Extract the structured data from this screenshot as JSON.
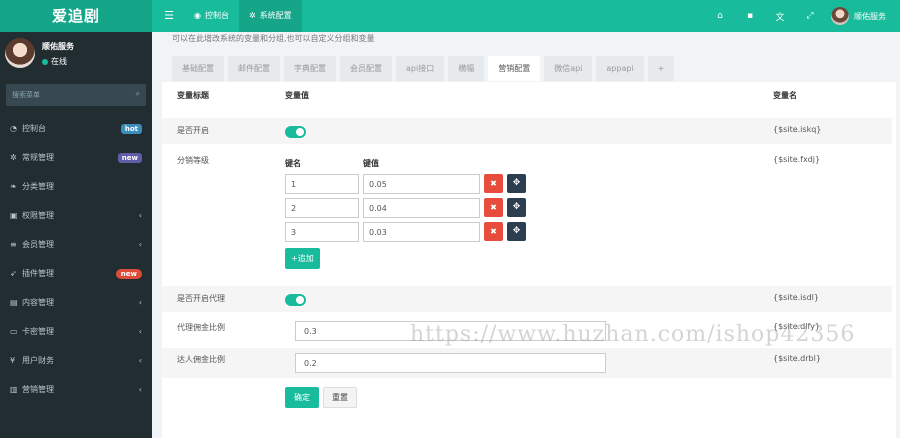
{
  "app": {
    "logo": "爱追剧"
  },
  "topnav": {
    "menu_icon": "menu-icon",
    "items": [
      {
        "icon": "dashboard-icon",
        "label": "控制台"
      },
      {
        "icon": "gear-icon",
        "label": "系统配置"
      }
    ],
    "right_icons": [
      "home-icon",
      "trash-icon",
      "translate-icon",
      "fullscreen-icon"
    ],
    "user_name": "顺佑服务"
  },
  "sidebar": {
    "user_name": "顺佑服务",
    "status": "在线",
    "search_placeholder": "搜索菜单",
    "items": [
      {
        "icon": "dashboard-icon",
        "label": "控制台",
        "badge": "hot"
      },
      {
        "icon": "cogs-icon",
        "label": "常规管理",
        "badge": "new"
      },
      {
        "icon": "leaf-icon",
        "label": "分类管理"
      },
      {
        "icon": "group-icon",
        "label": "权限管理"
      },
      {
        "icon": "list-icon",
        "label": "会员管理"
      },
      {
        "icon": "rocket-icon",
        "label": "插件管理",
        "badge": "new"
      },
      {
        "icon": "file-icon",
        "label": "内容管理"
      },
      {
        "icon": "card-icon",
        "label": "卡密管理"
      },
      {
        "icon": "yen-icon",
        "label": "用户财务"
      },
      {
        "icon": "chart-icon",
        "label": "营销管理"
      }
    ]
  },
  "main": {
    "description": "可以在此增改系统的变量和分组,也可以自定义分组和变量",
    "tabs": [
      "基础配置",
      "邮件配置",
      "字典配置",
      "会员配置",
      "api接口",
      "横幅",
      "营销配置",
      "微信api",
      "appapi",
      "+"
    ],
    "active_tab": "营销配置",
    "columns": {
      "title": "变量标题",
      "value": "变量值",
      "name": "变量名"
    },
    "rows": {
      "iskq": {
        "label": "是否开启",
        "var": "{$site.iskq}"
      },
      "fxdj": {
        "label": "分销等级",
        "var": "{$site.fxdj}",
        "key_header": "键名",
        "value_header": "键值",
        "entries": [
          {
            "key": "1",
            "value": "0.05"
          },
          {
            "key": "2",
            "value": "0.04"
          },
          {
            "key": "3",
            "value": "0.03"
          }
        ],
        "add_label": "+追加"
      },
      "isdl": {
        "label": "是否开启代理",
        "var": "{$site.isdl}"
      },
      "dlfy": {
        "label": "代理佣金比例",
        "var": "{$site.dlfy}",
        "value": "0.3"
      },
      "drbl": {
        "label": "达人佣金比例",
        "var": "{$site.drbl}",
        "value": "0.2"
      }
    },
    "submit_label": "确定",
    "reset_label": "重置"
  },
  "watermark": "https://www.huzhan.com/ishop42356"
}
